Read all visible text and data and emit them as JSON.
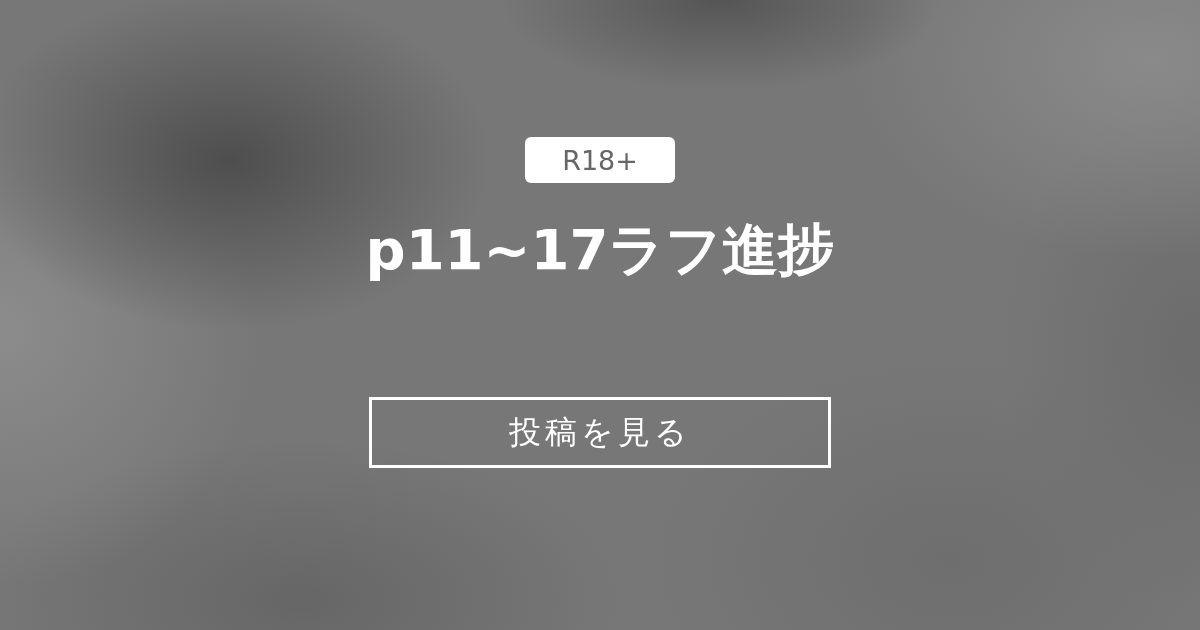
{
  "badge": {
    "label": "R18+"
  },
  "title": "p11~17ラフ進捗",
  "button": {
    "label": "投稿を見る"
  }
}
